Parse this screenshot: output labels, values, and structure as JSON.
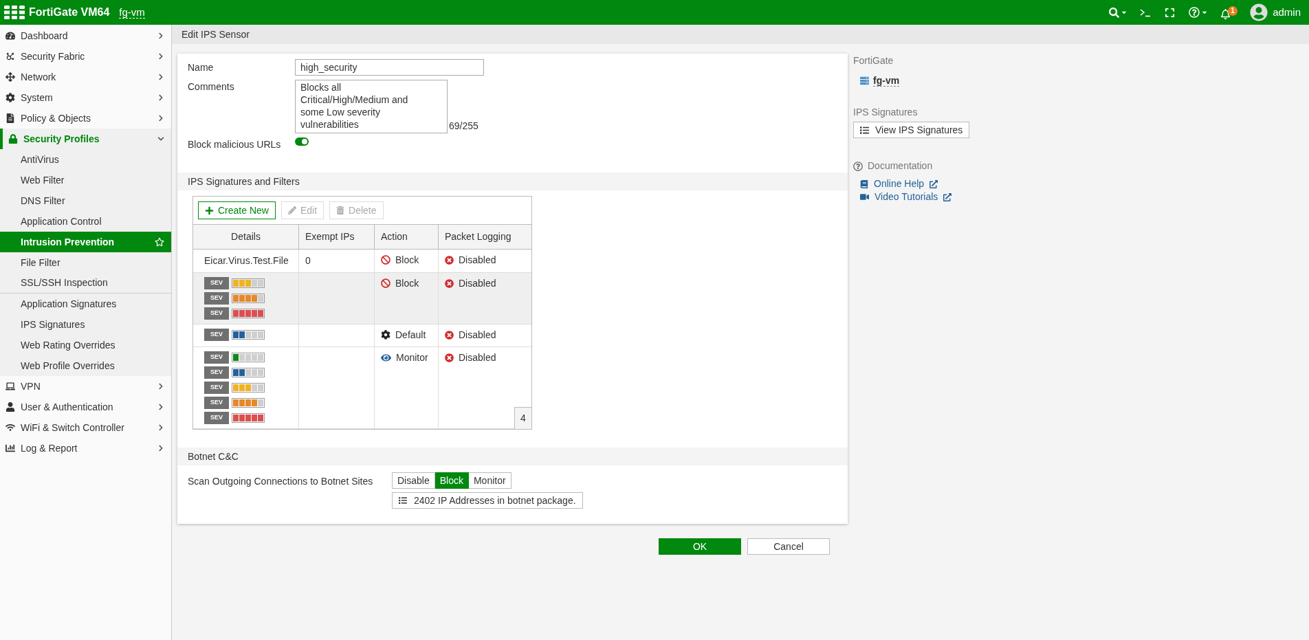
{
  "topbar": {
    "product": "FortiGate VM64",
    "hostname": "fg-vm",
    "notification_count": "1",
    "user": "admin"
  },
  "sidebar": {
    "items": [
      {
        "label": "Dashboard",
        "expanded": false,
        "selected": false
      },
      {
        "label": "Security Fabric",
        "expanded": false,
        "selected": false
      },
      {
        "label": "Network",
        "expanded": false,
        "selected": false
      },
      {
        "label": "System",
        "expanded": false,
        "selected": false
      },
      {
        "label": "Policy & Objects",
        "expanded": false,
        "selected": false
      },
      {
        "label": "Security Profiles",
        "expanded": true,
        "selected": true,
        "children": [
          {
            "label": "AntiVirus",
            "selected": false,
            "divider_after": false
          },
          {
            "label": "Web Filter",
            "selected": false,
            "divider_after": false
          },
          {
            "label": "DNS Filter",
            "selected": false,
            "divider_after": false
          },
          {
            "label": "Application Control",
            "selected": false,
            "divider_after": false
          },
          {
            "label": "Intrusion Prevention",
            "selected": true,
            "divider_after": false
          },
          {
            "label": "File Filter",
            "selected": false,
            "divider_after": false
          },
          {
            "label": "SSL/SSH Inspection",
            "selected": false,
            "divider_after": true
          },
          {
            "label": "Application Signatures",
            "selected": false,
            "divider_after": false
          },
          {
            "label": "IPS Signatures",
            "selected": false,
            "divider_after": false
          },
          {
            "label": "Web Rating Overrides",
            "selected": false,
            "divider_after": false
          },
          {
            "label": "Web Profile Overrides",
            "selected": false,
            "divider_after": false
          }
        ]
      },
      {
        "label": "VPN",
        "expanded": false,
        "selected": false
      },
      {
        "label": "User & Authentication",
        "expanded": false,
        "selected": false
      },
      {
        "label": "WiFi & Switch Controller",
        "expanded": false,
        "selected": false
      },
      {
        "label": "Log & Report",
        "expanded": false,
        "selected": false
      }
    ]
  },
  "page_title": "Edit IPS Sensor",
  "form": {
    "name_label": "Name",
    "name_value": "high_security",
    "comments_label": "Comments",
    "comments_value": "Blocks all Critical/High/Medium and some Low severity vulnerabilities",
    "comments_counter": "69/255",
    "block_urls_label": "Block malicious URLs",
    "block_urls_on": true
  },
  "filters_section": {
    "title": "IPS Signatures and Filters",
    "toolbar": [
      {
        "label": "Create New",
        "kind": "create",
        "disabled": false
      },
      {
        "label": "Edit",
        "kind": "edit",
        "disabled": true
      },
      {
        "label": "Delete",
        "kind": "delete",
        "disabled": true
      }
    ],
    "columns": [
      "Details",
      "Exempt IPs",
      "Action",
      "Packet Logging"
    ],
    "rows": [
      {
        "kind": "signature",
        "selected": false,
        "details": "Eicar.Virus.Test.File",
        "exempt_ips": "0",
        "action": {
          "kind": "block",
          "label": "Block"
        },
        "packet_logging": "Disabled"
      },
      {
        "kind": "filter",
        "selected": true,
        "severities": [
          {
            "label": "SEV",
            "level": 0.6,
            "color": "#f0b323"
          },
          {
            "label": "SEV",
            "level": 0.8,
            "color": "#e5892a"
          },
          {
            "label": "SEV",
            "level": 1,
            "color": "#dc4f4f"
          }
        ],
        "action": {
          "kind": "block",
          "label": "Block"
        },
        "packet_logging": "Disabled"
      },
      {
        "kind": "filter",
        "selected": false,
        "severities": [
          {
            "label": "SEV",
            "level": 0.4,
            "color": "#23629b"
          }
        ],
        "action": {
          "kind": "default",
          "label": "Default"
        },
        "packet_logging": "Disabled"
      },
      {
        "kind": "filter",
        "selected": false,
        "severities": [
          {
            "label": "SEV",
            "level": 0.2,
            "color": "#0c8a1b"
          },
          {
            "label": "SEV",
            "level": 0.4,
            "color": "#23629b"
          },
          {
            "label": "SEV",
            "level": 0.6,
            "color": "#f0b323"
          },
          {
            "label": "SEV",
            "level": 0.8,
            "color": "#e5892a"
          },
          {
            "label": "SEV",
            "level": 1,
            "color": "#dc4f4f"
          }
        ],
        "action": {
          "kind": "monitor",
          "label": "Monitor"
        },
        "packet_logging": "Disabled"
      }
    ],
    "row_count": "4"
  },
  "botnet_section": {
    "title": "Botnet C&C",
    "scan_label": "Scan Outgoing Connections to Botnet Sites",
    "options": [
      {
        "label": "Disable",
        "selected": false
      },
      {
        "label": "Block",
        "selected": true
      },
      {
        "label": "Monitor",
        "selected": false
      }
    ],
    "package_button": "2402 IP Addresses in botnet package."
  },
  "buttons": [
    {
      "label": "OK",
      "kind": "primary"
    },
    {
      "label": "Cancel",
      "kind": "secondary"
    }
  ],
  "right_panel": {
    "device_heading": "FortiGate",
    "device_name": "fg-vm",
    "signatures_heading": "IPS Signatures",
    "view_signatures_button": "View IPS Signatures",
    "docs_heading": "Documentation",
    "links": [
      "Online Help",
      "Video Tutorials"
    ]
  }
}
